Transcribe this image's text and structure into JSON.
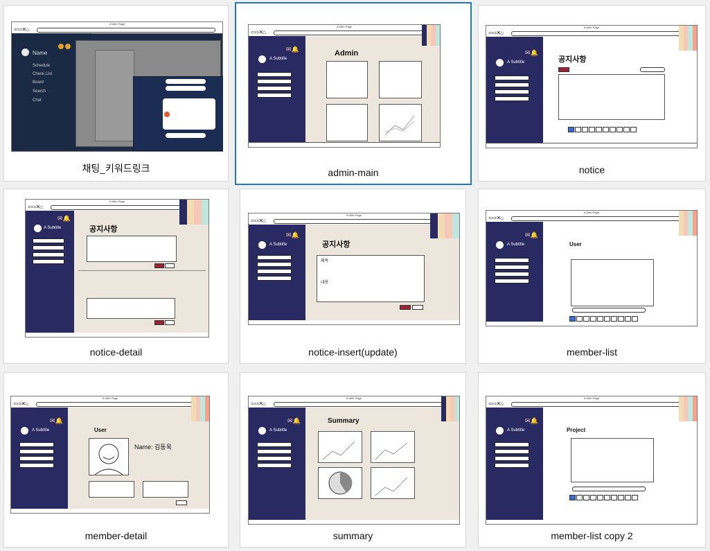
{
  "tiles": [
    {
      "caption": "채팅_키워드링크",
      "selected": false
    },
    {
      "caption": "admin-main",
      "selected": true
    },
    {
      "caption": "notice",
      "selected": false
    },
    {
      "caption": "notice-detail",
      "selected": false
    },
    {
      "caption": "notice-insert(update)",
      "selected": false
    },
    {
      "caption": "member-list",
      "selected": false
    },
    {
      "caption": "member-detail",
      "selected": false
    },
    {
      "caption": "summary",
      "selected": false
    },
    {
      "caption": "member-list copy 2",
      "selected": false
    }
  ],
  "mock": {
    "window_title": "A Web Page",
    "subtitle": "A Subtitle",
    "sidebar_menu": [
      "Combobox",
      "Combobox",
      "Combobox",
      "Combobox"
    ],
    "chat_menu": [
      "Name",
      "Schedule",
      "Check List",
      "Board",
      "Search",
      "Chat"
    ],
    "admin_title": "Admin",
    "notice_title": "공지사항",
    "user_title": "User",
    "member_name": "Name: 김동욱",
    "summary_title": "Summary",
    "project_title": "Project",
    "insert_labels": [
      "제목",
      "내용"
    ],
    "colors": {
      "sidebar": "#2a2a63",
      "content": "#ece6dc",
      "accent": "#1f77c0",
      "strip": [
        "#2a2a63",
        "#f3dbb3",
        "#f7c7b8",
        "#bfe6df",
        "#f4a48a"
      ]
    }
  }
}
